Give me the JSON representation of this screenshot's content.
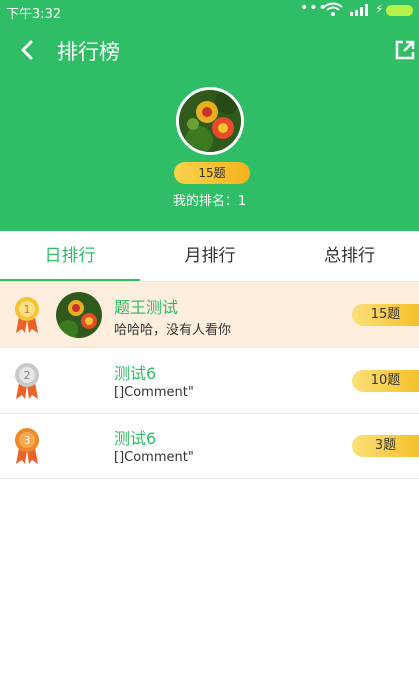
{
  "status_bar": {
    "time": "下午3:32",
    "dots": "•••"
  },
  "header": {
    "title": "排行榜",
    "question_count": "15题",
    "my_rank": "我的排名：1"
  },
  "tabs": [
    {
      "label": "日排行",
      "active": true
    },
    {
      "label": "月排行",
      "active": false
    },
    {
      "label": "总排行",
      "active": false
    }
  ],
  "leaderboard": [
    {
      "rank": "1",
      "name": "题王测试",
      "comment": "哈哈哈，没有人看你",
      "count": "15题",
      "medal": "gold",
      "highlighted": true,
      "has_avatar": true
    },
    {
      "rank": "2",
      "name": "测试6",
      "comment": "[]Comment\"",
      "count": "10题",
      "medal": "silver",
      "highlighted": false,
      "has_avatar": false
    },
    {
      "rank": "3",
      "name": "测试6",
      "comment": "[]Comment\"",
      "count": "3题",
      "medal": "bronze",
      "highlighted": false,
      "has_avatar": false
    }
  ],
  "colors": {
    "primary": "#2fbd66",
    "highlight_row": "#fdeedd",
    "pill": "#f6c12a"
  }
}
